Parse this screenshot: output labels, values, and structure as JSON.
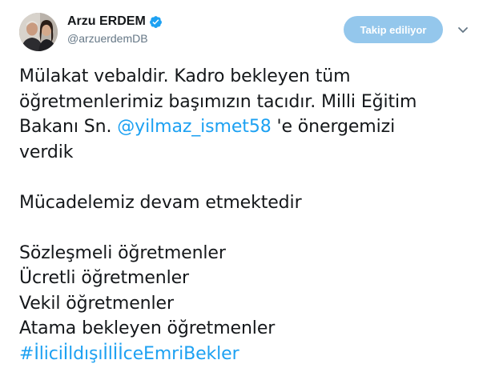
{
  "user": {
    "display_name": "Arzu ERDEM",
    "screen_name": "@arzuerdemDB",
    "verified": true,
    "avatar_icon": "profile-photo"
  },
  "follow_button": {
    "label": "Takip ediliyor",
    "color": "#94c7ec"
  },
  "menu_icon": "chevron-down-icon",
  "tweet": {
    "line1": "Mülakat vebaldir. Kadro bekleyen tüm",
    "line2": "öğretmenlerimiz başımızın tacıdır. Milli Eğitim",
    "line3_before": "Bakanı Sn. ",
    "mention": "@yilmaz_ismet58",
    "line3_after": " 'e önergemizi",
    "line4": "verdik",
    "line5": "Mücadelemiz devam etmektedir",
    "line6": "Sözleşmeli öğretmenler",
    "line7": "Ücretli öğretmenler",
    "line8": "Vekil öğretmenler",
    "line9": "Atama bekleyen öğretmenler",
    "hashtag": "#İliciİldışıİlİİceEmriBekler"
  },
  "colors": {
    "link": "#1da1f2",
    "text": "#14171a",
    "secondary": "#657786"
  }
}
